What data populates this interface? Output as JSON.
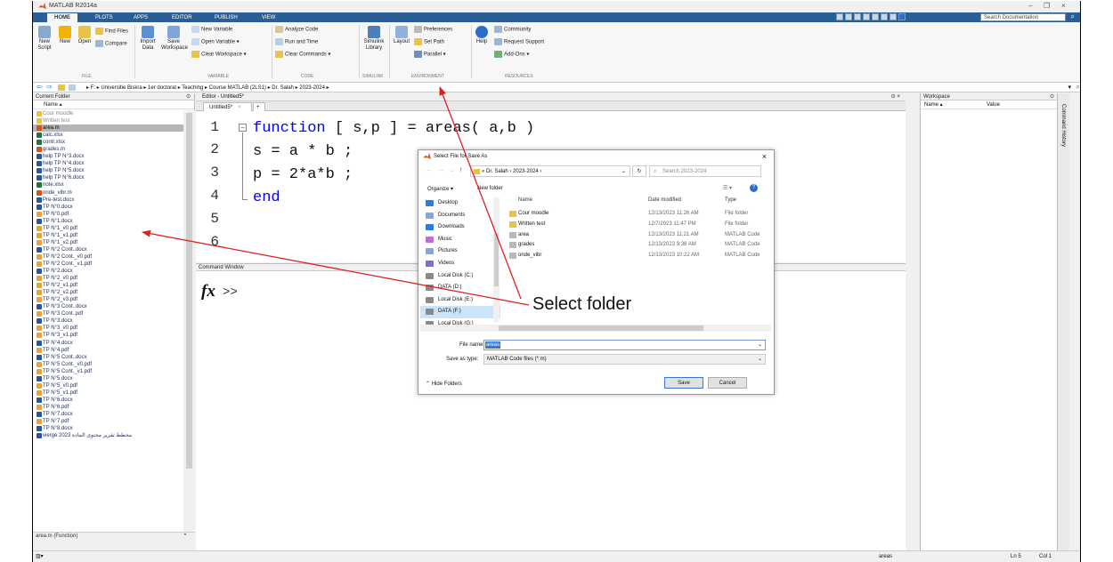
{
  "window": {
    "title": "MATLAB R2014a",
    "controls": [
      "–",
      "❐",
      "×"
    ]
  },
  "ribbon_tabs": [
    "HOME",
    "PLOTS",
    "APPS",
    "EDITOR",
    "PUBLISH",
    "VIEW"
  ],
  "search_placeholder": "Search Documentation",
  "ribbon": {
    "new_script": "New\nScript",
    "new": "New",
    "open": "Open",
    "find_files": "Find Files",
    "compare": "Compare",
    "import_data": "Import\nData",
    "save_workspace": "Save\nWorkspace",
    "new_variable": "New Variable",
    "open_variable": "Open Variable ▾",
    "clear_workspace": "Clear Workspace ▾",
    "analyze_code": "Analyze Code",
    "run_and_time": "Run and Time",
    "clear_commands": "Clear Commands ▾",
    "simulink_library": "Simulink\nLibrary",
    "layout": "Layout",
    "preferences": "Preferences",
    "set_path": "Set Path",
    "parallel": "Parallel ▾",
    "help": "Help",
    "community": "Community",
    "request_support": "Request Support",
    "add_ons": "Add-Ons ▾",
    "groups": [
      "FILE",
      "VARIABLE",
      "CODE",
      "SIMULINK",
      "ENVIRONMENT",
      "RESOURCES"
    ]
  },
  "address_path": "▸ F: ▸ Universitie Biskra ▸ 1er doctorat ▸ Teaching ▸ Course MATLAB (2LS1) ▸ Dr. Salah ▸ 2023-2024 ▸",
  "current_folder": {
    "title": "Current Folder",
    "col_name": "Name ▴",
    "files": [
      "Cour moodle",
      "Written test",
      "area.m",
      "calc.xlsx",
      "contr.xlsx",
      "grades.m",
      "help TP N°3.docx",
      "help TP N°4.docx",
      "help TP N°5.docx",
      "help TP N°6.docx",
      "note.xlsx",
      "onde_vibr.m",
      "Pre-test.docx",
      "TP N°0.docx",
      "TP N°0.pdf",
      "TP N°1.docx",
      "TP N°1_v0.pdf",
      "TP N°1_v1.pdf",
      "TP N°1_v2.pdf",
      "TP N°2 Cont..docx",
      "TP N°2 Cont._v0.pdf",
      "TP N°2 Cont._v1.pdf",
      "TP N°2.docx",
      "TP N°2_v0.pdf",
      "TP N°2_v1.pdf",
      "TP N°2_v2.pdf",
      "TP N°2_v3.pdf",
      "TP N°3 Cont..docx",
      "TP N°3 Cont..pdf",
      "TP N°3.docx",
      "TP N°3_v0.pdf",
      "TP N°3_v1.pdf",
      "TP N°4.docx",
      "TP N°4.pdf",
      "TP N°5 Cont..docx",
      "TP N°5 Cont._v0.pdf",
      "TP N°5 Cont._v1.pdf",
      "TP N°5.docx",
      "TP N°5_v0.pdf",
      "TP N°5_v1.pdf",
      "TP N°6.docx",
      "TP N°6.pdf",
      "TP N°7.docx",
      "TP N°7.pdf",
      "TP N°8.docx",
      "vierge 2023 مخطط تقرير محتوى المادة"
    ],
    "details": "area.m (Function)"
  },
  "editor": {
    "header": "Editor - Untitled5*",
    "tab": "Untitled5*",
    "line_numbers": [
      "1",
      "2",
      "3",
      "4",
      "5",
      "6"
    ],
    "lines": [
      {
        "kw": "function",
        "rest": " [ s,p ] = areas( a,b )"
      },
      {
        "kw": "",
        "rest": "s = a * b ;"
      },
      {
        "kw": "",
        "rest": "p = 2*a*b ;"
      },
      {
        "kw": "end",
        "rest": ""
      }
    ]
  },
  "command_window": {
    "title": "Command Window",
    "prompt": ">>",
    "fx": "fx"
  },
  "workspace": {
    "title": "Workspace",
    "col_name": "Name ▴",
    "col_value": "Value"
  },
  "command_history": {
    "title": "Command History"
  },
  "dialog": {
    "title": "Select File for Save As",
    "breadcrumb": "« Dr. Salah › 2023-2024 ›",
    "search_placeholder": "Search 2023-2024",
    "organize": "Organize ▾",
    "new_folder": "New folder",
    "nav_items": [
      "Desktop",
      "Documents",
      "Downloads",
      "Music",
      "Pictures",
      "Videos",
      "Local Disk (C:)",
      "DATA (D:)",
      "Local Disk (E:)",
      "DATA (F:)",
      "Local Disk (G:)"
    ],
    "col_name": "Name",
    "col_date": "Date modified",
    "col_type": "Type",
    "files": [
      {
        "name": "Cour moodle",
        "date": "12/13/2023 11:26 AM",
        "type": "File folder"
      },
      {
        "name": "Written test",
        "date": "12/7/2023 11:47 PM",
        "type": "File folder"
      },
      {
        "name": "area",
        "date": "12/13/2023 11:21 AM",
        "type": "MATLAB Code"
      },
      {
        "name": "grades",
        "date": "12/13/2023 9:38 AM",
        "type": "MATLAB Code"
      },
      {
        "name": "onde_vibr",
        "date": "12/13/2023 10:22 AM",
        "type": "MATLAB Code"
      }
    ],
    "filename_label": "File name:",
    "filename_value": "areas",
    "savetype_label": "Save as type:",
    "savetype_value": "MATLAB Code files (*.m)",
    "hide_folders": "Hide Folders",
    "save": "Save",
    "cancel": "Cancel"
  },
  "annotation": {
    "label": "Select folder",
    "color": "#e02020"
  },
  "status": {
    "text": "areas",
    "ln": "Ln 5",
    "col": "Col 1"
  }
}
